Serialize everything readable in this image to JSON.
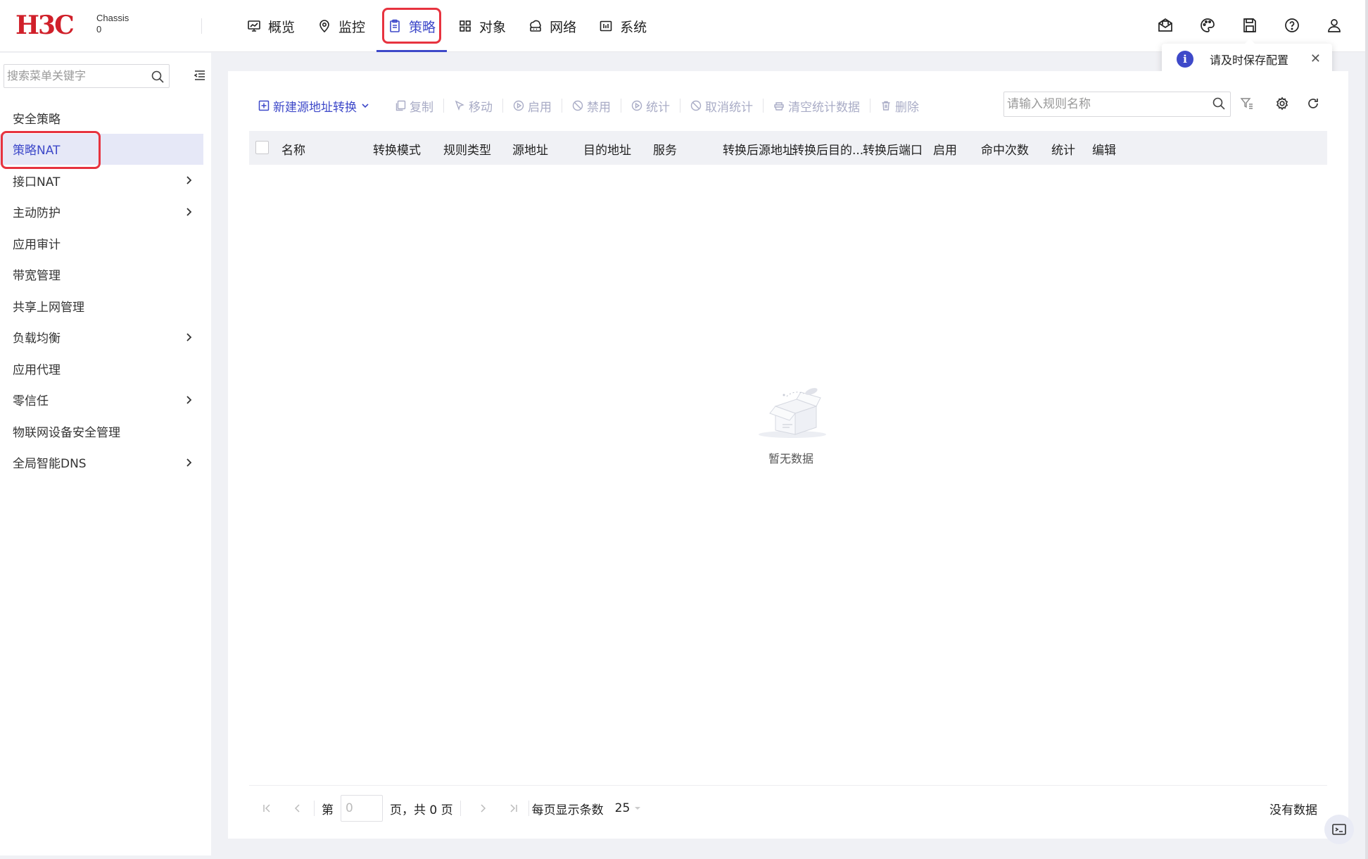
{
  "brand": {
    "logo_text": "H3C",
    "device_line1": "Chassis",
    "device_line2": "0"
  },
  "nav": {
    "items": [
      {
        "label": "概览",
        "icon": "monitor-icon"
      },
      {
        "label": "监控",
        "icon": "location-pin-icon"
      },
      {
        "label": "策略",
        "icon": "clipboard-icon",
        "active": true
      },
      {
        "label": "对象",
        "icon": "grid-icon"
      },
      {
        "label": "网络",
        "icon": "cloud-network-icon"
      },
      {
        "label": "系统",
        "icon": "system-icon"
      }
    ]
  },
  "header_icons": [
    "mail-icon",
    "palette-icon",
    "save-icon",
    "help-icon",
    "user-icon"
  ],
  "toast": {
    "text": "请及时保存配置"
  },
  "sidebar": {
    "search_placeholder": "搜索菜单关键字",
    "items": [
      {
        "label": "安全策略",
        "has_children": false
      },
      {
        "label": "策略NAT",
        "has_children": false,
        "active": true
      },
      {
        "label": "接口NAT",
        "has_children": true
      },
      {
        "label": "主动防护",
        "has_children": true
      },
      {
        "label": "应用审计",
        "has_children": false
      },
      {
        "label": "带宽管理",
        "has_children": false
      },
      {
        "label": "共享上网管理",
        "has_children": false
      },
      {
        "label": "负载均衡",
        "has_children": true
      },
      {
        "label": "应用代理",
        "has_children": false
      },
      {
        "label": "零信任",
        "has_children": true
      },
      {
        "label": "物联网设备安全管理",
        "has_children": false
      },
      {
        "label": "全局智能DNS",
        "has_children": true
      }
    ]
  },
  "toolbar": {
    "new_label": "新建源地址转换",
    "copy_label": "复制",
    "move_label": "移动",
    "enable_label": "启用",
    "disable_label": "禁用",
    "stats_label": "统计",
    "cancel_stats_label": "取消统计",
    "clear_stats_label": "清空统计数据",
    "delete_label": "删除",
    "search_placeholder": "请输入规则名称"
  },
  "table": {
    "columns": [
      "名称",
      "转换模式",
      "规则类型",
      "源地址",
      "目的地址",
      "服务",
      "转换后源地址",
      "转换后目的...",
      "转换后端口",
      "启用",
      "命中次数",
      "统计",
      "编辑"
    ],
    "rows": [],
    "empty_text": "暂无数据"
  },
  "pagination": {
    "page_prefix": "第",
    "page_value": "0",
    "page_suffix": "页，共 0 页",
    "per_page_label": "每页显示条数",
    "per_page_value": "25",
    "status": "没有数据"
  },
  "colors": {
    "accent": "#3e49c9",
    "brand": "#d0202a",
    "highlight": "#e7333f",
    "disabled": "#a9acc6"
  }
}
